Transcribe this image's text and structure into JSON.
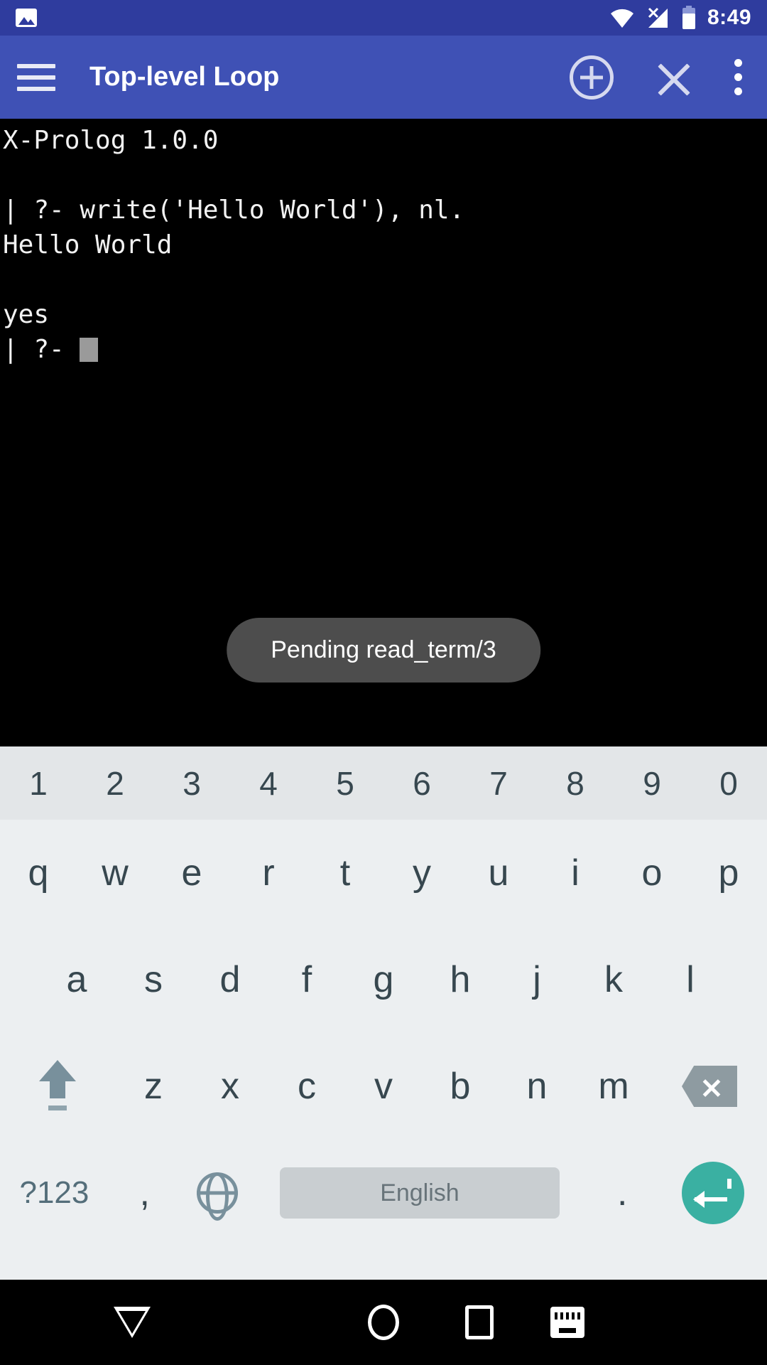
{
  "status_bar": {
    "notification_icon": "image-icon",
    "wifi_icon": "wifi-icon",
    "signal_icon": "cellular-no-sim-icon",
    "battery_icon": "battery-icon",
    "time": "8:49",
    "bg_color": "#2f3c9e"
  },
  "app_bar": {
    "menu_icon": "hamburger-menu-icon",
    "title": "Top-level Loop",
    "add_icon": "plus-circle-icon",
    "close_icon": "close-x-icon",
    "overflow_icon": "overflow-menu-icon",
    "bg_color": "#3f51b5"
  },
  "terminal": {
    "bg_color": "#000000",
    "text_color": "#f2f2f2",
    "lines": [
      "X-Prolog 1.0.0",
      "",
      "| ?- write('Hello World'), nl.",
      "Hello World",
      "",
      "yes"
    ],
    "prompt": "| ?- ",
    "cursor_color": "#9a9a9a"
  },
  "toast": {
    "message": "Pending read_term/3",
    "bg_color": "#4d4d4d"
  },
  "keyboard": {
    "bg_color": "#eceff1",
    "key_color": "#37474f",
    "number_row": [
      "1",
      "2",
      "3",
      "4",
      "5",
      "6",
      "7",
      "8",
      "9",
      "0"
    ],
    "row_qwerty": [
      "q",
      "w",
      "e",
      "r",
      "t",
      "y",
      "u",
      "i",
      "o",
      "p"
    ],
    "row_asdf": [
      "a",
      "s",
      "d",
      "f",
      "g",
      "h",
      "j",
      "k",
      "l"
    ],
    "row_zxcv": [
      "z",
      "x",
      "c",
      "v",
      "b",
      "n",
      "m"
    ],
    "shift_icon": "shift-icon",
    "backspace_icon": "backspace-icon",
    "symbols_label": "?123",
    "comma_label": ",",
    "globe_icon": "language-globe-icon",
    "space_label": "English",
    "period_label": ".",
    "enter_icon": "enter-return-icon",
    "enter_color": "#3ab0a2"
  },
  "nav_bar": {
    "back_icon": "keyboard-dismiss-icon",
    "home_icon": "home-circle-icon",
    "recents_icon": "recents-square-icon",
    "keyboard_switch_icon": "keyboard-switcher-icon",
    "bg_color": "#000000"
  }
}
